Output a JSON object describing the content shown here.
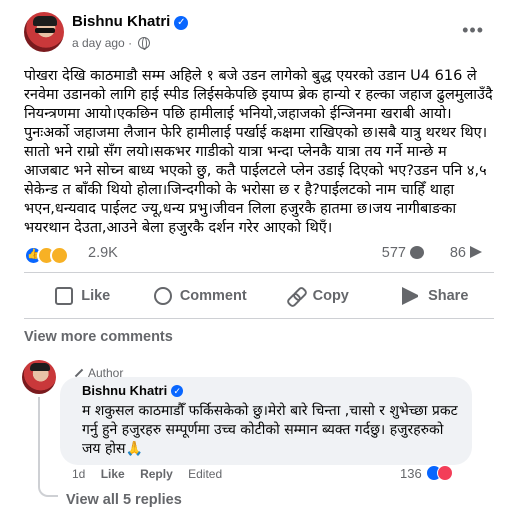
{
  "post": {
    "author": "Bishnu Khatri",
    "time": "a day ago",
    "separator": "·",
    "text": "पोखरा देखि काठमाडौ सम्म अहिले १ बजे उडन लागेको बुद्ध एयरको उडान U4 616 ले रनवेमा उडानको लागि हाई स्पीड लिईसकेपछि  इयाप्प ब्रेक हान्यो र हल्का जहाज ढुलमुलाउँदै नियन्त्रणमा आयो।एकछिन पछि हामीलाई भनियो,जहाजको ईन्जिनमा खराबी आयो।पुनःअर्को जहाजमा लैजान फेरि हामीलाई पर्खाई कक्षमा राखिएको छ।सबै यात्रु थरथर थिए।सातो भने राम्रो सँग लयो।सकभर गाडीको यात्रा भन्दा प्लेनकै यात्रा तय गर्ने मान्छे म आजबाट भने सोच्न बाध्य भएको छु, कतै पाईलटले प्लेन उडाई दिएको भए?उडन पनि ४,५ सेकेन्ड त बाँकी थियो होला।जिन्दगीको के भरोसा छ र है?पाईलटको नाम चाहिँ थाहा भएन,धन्यवाद पाईलट ज्यू,धन्य प्रभु।जीवन लिला हजुरकै हातमा छ।जय नागीबाङका भयरथान देउता,आउने बेला हजुरकै दर्शन गरेर आएको थिएँ।"
  },
  "stats": {
    "reactions": "2.9K",
    "comments": "577",
    "shares": "86"
  },
  "actions": {
    "like": "Like",
    "comment": "Comment",
    "copy": "Copy",
    "share": "Share"
  },
  "view_more_comments": "View more comments",
  "comment": {
    "badge": "Author",
    "author": "Bishnu Khatri",
    "text": "म शकुसल काठमाडौँ फर्किसकेको छु।मेरो बारे चिन्ता ,चासो र शुभेच्छा प्रकट गर्नु हुने हजुरहरु सम्पूर्णमा उच्च कोटीको सम्मान ब्यक्त गर्दछु। हजुरहरुको जय होस🙏",
    "age": "1d",
    "like": "Like",
    "reply": "Reply",
    "edited": "Edited",
    "reaction_count": "136"
  },
  "view_replies": "View all 5 replies",
  "icons": [
    "verified-badge-icon",
    "globe-icon",
    "more-options-icon",
    "like-reaction-icon",
    "sad-reaction-icon",
    "care-reaction-icon",
    "comment-icon",
    "share-icon",
    "like-icon",
    "copy-link-icon",
    "pen-icon",
    "love-reaction-icon"
  ],
  "colors": {
    "accent": "#0866ff",
    "secondary_text": "#65676b",
    "bubble": "#f0f2f5"
  }
}
